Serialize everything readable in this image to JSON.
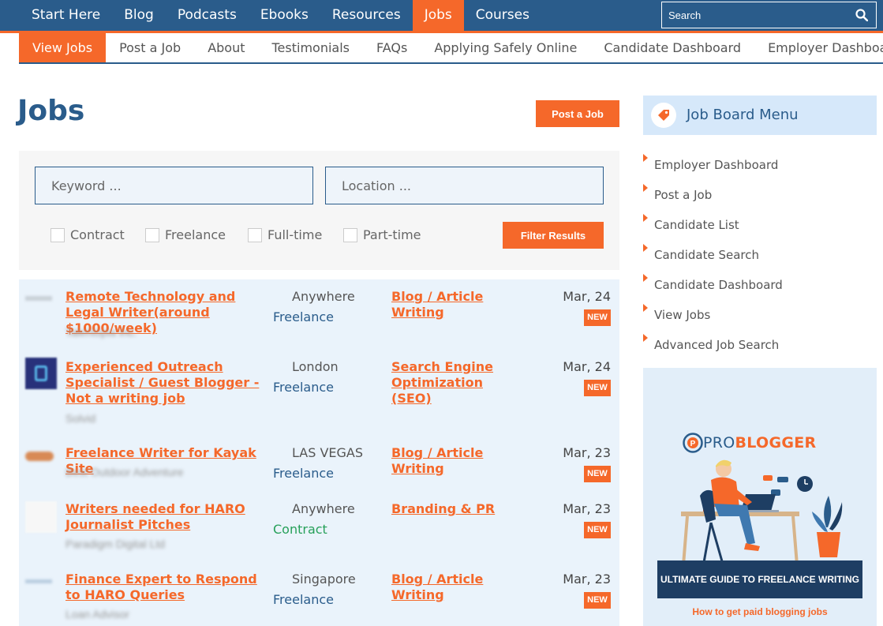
{
  "top_nav": {
    "items": [
      {
        "label": "Start Here",
        "active": false
      },
      {
        "label": "Blog",
        "active": false
      },
      {
        "label": "Podcasts",
        "active": false
      },
      {
        "label": "Ebooks",
        "active": false
      },
      {
        "label": "Resources",
        "active": false
      },
      {
        "label": "Jobs",
        "active": true
      },
      {
        "label": "Courses",
        "active": false
      }
    ],
    "search_placeholder": "Search"
  },
  "sub_nav": {
    "items": [
      {
        "label": "View Jobs",
        "active": true
      },
      {
        "label": "Post a Job",
        "active": false
      },
      {
        "label": "About",
        "active": false
      },
      {
        "label": "Testimonials",
        "active": false
      },
      {
        "label": "FAQs",
        "active": false
      },
      {
        "label": "Applying Safely Online",
        "active": false
      },
      {
        "label": "Candidate Dashboard",
        "active": false
      },
      {
        "label": "Employer Dashboard",
        "active": false
      }
    ]
  },
  "main": {
    "title": "Jobs",
    "post_job_label": "Post a Job",
    "filters": {
      "keyword_placeholder": "Keyword ...",
      "location_placeholder": "Location ...",
      "checkboxes": [
        "Contract",
        "Freelance",
        "Full-time",
        "Part-time"
      ],
      "filter_button": "Filter Results"
    },
    "jobs": [
      {
        "title": "Remote Technology and Legal Writer(around $1000/week)",
        "company": "Talentopia Inc.",
        "location": "Anywhere",
        "type": "Freelance",
        "category": "Blog / Article Writing",
        "date": "Mar, 24",
        "badge": "NEW"
      },
      {
        "title": "Experienced Outreach Specialist / Guest Blogger - Not a writing job",
        "company": "Solvid",
        "location": "London",
        "type": "Freelance",
        "category": "Search Engine Optimization (SEO)",
        "date": "Mar, 24",
        "badge": "NEW"
      },
      {
        "title": "Freelance Writer for Kayak Site",
        "company": "Best Outdoor Adventure",
        "location": "LAS VEGAS",
        "type": "Freelance",
        "category": "Blog / Article Writing",
        "date": "Mar, 23",
        "badge": "NEW"
      },
      {
        "title": "Writers needed for HARO Journalist Pitches",
        "company": "Paradigm Digital Ltd",
        "location": "Anywhere",
        "type": "Contract",
        "category": "Branding & PR",
        "date": "Mar, 23",
        "badge": "NEW"
      },
      {
        "title": "Finance Expert to Respond to HARO Queries",
        "company": "Loan Advisor",
        "location": "Singapore",
        "type": "Freelance",
        "category": "Blog / Article Writing",
        "date": "Mar, 23",
        "badge": "NEW"
      }
    ]
  },
  "sidebar": {
    "menu_title": "Job Board Menu",
    "items": [
      "Employer Dashboard",
      "Post a Job",
      "Candidate List",
      "Candidate Search",
      "Candidate Dashboard",
      "View Jobs",
      "Advanced Job Search"
    ],
    "ad": {
      "logo_pro": "PRO",
      "logo_blogger": "BLOGGER",
      "banner": "ULTIMATE GUIDE TO FREELANCE WRITING",
      "sub": "How to get paid blogging jobs"
    }
  },
  "colors": {
    "brand_blue": "#2a5c8b",
    "accent_orange": "#f5682a",
    "contract_green": "#27a05a"
  }
}
